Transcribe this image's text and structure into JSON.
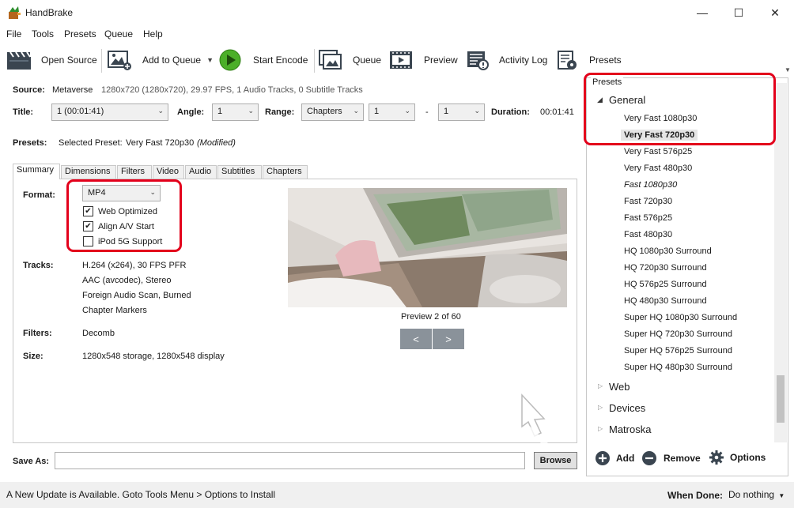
{
  "window": {
    "title": "HandBrake",
    "controls": {
      "minimize": "—",
      "maximize": "☐",
      "close": "✕"
    }
  },
  "menu": [
    "File",
    "Tools",
    "Presets",
    "Queue",
    "Help"
  ],
  "toolbar": {
    "open_source": "Open Source",
    "add_to_queue": "Add to Queue",
    "start_encode": "Start Encode",
    "queue": "Queue",
    "preview": "Preview",
    "activity_log": "Activity Log",
    "presets": "Presets"
  },
  "source": {
    "label": "Source:",
    "name": "Metaverse",
    "info": "1280x720 (1280x720), 29.97 FPS, 1 Audio Tracks, 0 Subtitle Tracks"
  },
  "title_row": {
    "title_label": "Title:",
    "title_value": "1 (00:01:41)",
    "angle_label": "Angle:",
    "angle_value": "1",
    "range_label": "Range:",
    "range_value": "Chapters",
    "range_start": "1",
    "range_dash": "-",
    "range_end": "1",
    "duration_label": "Duration:",
    "duration_value": "00:01:41"
  },
  "presets_row": {
    "label": "Presets:",
    "selected_prefix": "Selected Preset:",
    "selected_name": "Very Fast 720p30",
    "modified": "(Modified)"
  },
  "tabs": [
    "Summary",
    "Dimensions",
    "Filters",
    "Video",
    "Audio",
    "Subtitles",
    "Chapters"
  ],
  "summary": {
    "format_label": "Format:",
    "format_value": "MP4",
    "web_optimized": "Web Optimized",
    "web_optimized_checked": true,
    "align_av": "Align A/V Start",
    "align_av_checked": true,
    "ipod": "iPod 5G Support",
    "ipod_checked": false,
    "tracks_label": "Tracks:",
    "tracks": [
      "H.264 (x264), 30 FPS PFR",
      "AAC (avcodec), Stereo",
      "Foreign Audio Scan, Burned",
      "Chapter Markers"
    ],
    "filters_label": "Filters:",
    "filters_value": "Decomb",
    "size_label": "Size:",
    "size_value": "1280x548 storage, 1280x548 display",
    "preview_caption": "Preview 2 of 60",
    "prev_btn": "<",
    "next_btn": ">"
  },
  "save": {
    "label": "Save As:",
    "value": "",
    "browse": "Browse"
  },
  "presets_panel": {
    "header": "Presets",
    "groups": [
      {
        "name": "General",
        "expanded": true,
        "items": [
          {
            "name": "Very Fast 1080p30",
            "style": "normal"
          },
          {
            "name": "Very Fast 720p30",
            "style": "selected"
          },
          {
            "name": "Very Fast 576p25",
            "style": "normal"
          },
          {
            "name": "Very Fast 480p30",
            "style": "normal"
          },
          {
            "name": "Fast 1080p30",
            "style": "italic"
          },
          {
            "name": "Fast 720p30",
            "style": "normal"
          },
          {
            "name": "Fast 576p25",
            "style": "normal"
          },
          {
            "name": "Fast 480p30",
            "style": "normal"
          },
          {
            "name": "HQ 1080p30 Surround",
            "style": "normal"
          },
          {
            "name": "HQ 720p30 Surround",
            "style": "normal"
          },
          {
            "name": "HQ 576p25 Surround",
            "style": "normal"
          },
          {
            "name": "HQ 480p30 Surround",
            "style": "normal"
          },
          {
            "name": "Super HQ 1080p30 Surround",
            "style": "normal"
          },
          {
            "name": "Super HQ 720p30 Surround",
            "style": "normal"
          },
          {
            "name": "Super HQ 576p25 Surround",
            "style": "normal"
          },
          {
            "name": "Super HQ 480p30 Surround",
            "style": "normal"
          }
        ]
      },
      {
        "name": "Web",
        "expanded": false
      },
      {
        "name": "Devices",
        "expanded": false
      },
      {
        "name": "Matroska",
        "expanded": false
      }
    ],
    "add": "Add",
    "remove": "Remove",
    "options": "Options"
  },
  "status": {
    "message": "A New Update is Available. Goto Tools Menu > Options to Install",
    "when_done_label": "When Done:",
    "when_done_value": "Do nothing"
  },
  "colors": {
    "highlight": "#e3001b",
    "selected_row": "#e5e5e5",
    "nav_button": "#8a929a",
    "start_green": "#4caf29"
  }
}
